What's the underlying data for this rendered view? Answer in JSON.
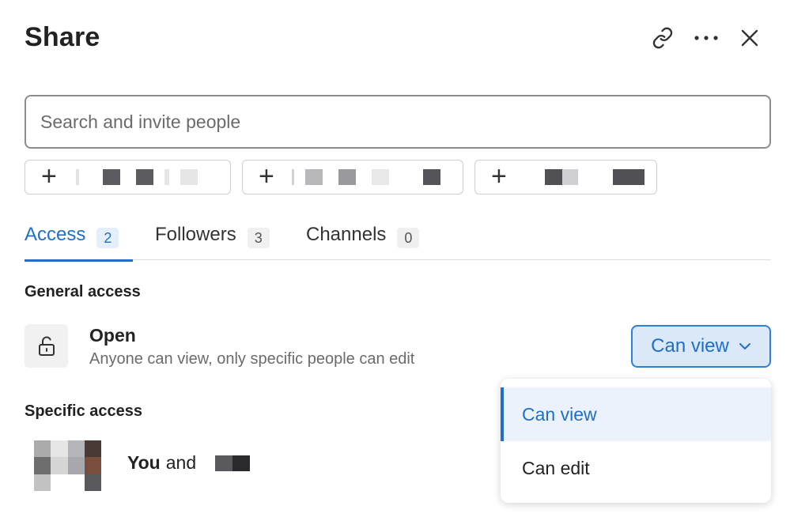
{
  "header": {
    "title": "Share",
    "icons": [
      "link-icon",
      "more-icon",
      "close-icon"
    ]
  },
  "search": {
    "placeholder": "Search and invite people",
    "value": ""
  },
  "suggestions": [
    {
      "icon": "plus-icon",
      "name": "redacted"
    },
    {
      "icon": "plus-icon",
      "name": "redacted"
    },
    {
      "icon": "plus-icon",
      "name": "redacted"
    }
  ],
  "tabs": [
    {
      "label": "Access",
      "count": "2",
      "active": true
    },
    {
      "label": "Followers",
      "count": "3",
      "active": false
    },
    {
      "label": "Channels",
      "count": "0",
      "active": false
    }
  ],
  "general_access": {
    "heading": "General access",
    "level": "Open",
    "description": "Anyone can view, only specific people can edit",
    "icon": "unlock-icon",
    "permission": "Can view"
  },
  "permission_menu": {
    "options": [
      "Can view",
      "Can edit"
    ],
    "selected": "Can view"
  },
  "specific_access": {
    "heading": "Specific access",
    "you_label": "You",
    "and_label": "and"
  },
  "colors": {
    "accent": "#1f6fc8",
    "accent_bg": "#dbe8f8",
    "menu_selected_bg": "#ebf2fb"
  }
}
